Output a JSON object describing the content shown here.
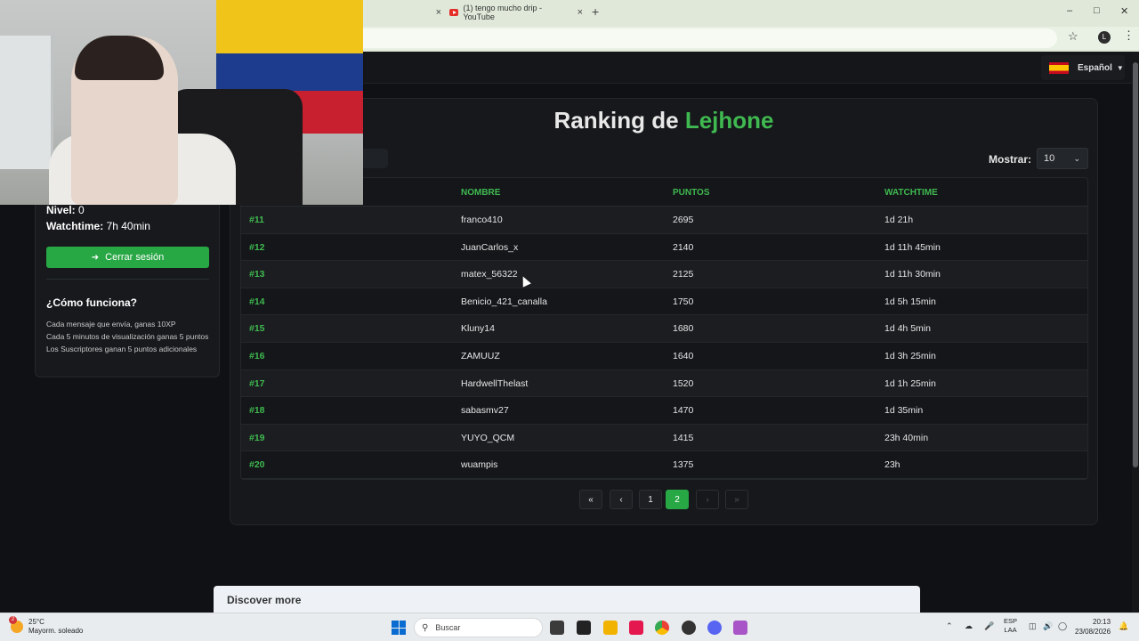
{
  "browser": {
    "tab1_close": "×",
    "tab2_title": "(1) tengo mucho drip - YouTube",
    "tab2_close": "×",
    "new_tab": "+",
    "profile_initial": "L"
  },
  "header": {
    "language": "Español"
  },
  "sidebar": {
    "nivel_label": "Nivel:",
    "nivel_value": "0",
    "watchtime_label": "Watchtime:",
    "watchtime_value": "7h 40min",
    "logout_label": "Cerrar sesión",
    "como_title": "¿Cómo funciona?",
    "rules": [
      "Cada mensaje que envía, ganas 10XP",
      "Cada 5 minutos de visualización ganas 5 puntos",
      "Los Suscriptores ganan 5 puntos adicionales"
    ]
  },
  "ranking": {
    "title_prefix": "Ranking de",
    "title_name": "Lejhone",
    "mostrar_label": "Mostrar:",
    "mostrar_value": "10",
    "columns": [
      "NOMBRE",
      "PUNTOS",
      "WATCHTIME"
    ],
    "rows": [
      {
        "rank": "#11",
        "name": "franco410",
        "points": "2695",
        "watchtime": "1d 21h"
      },
      {
        "rank": "#12",
        "name": "JuanCarlos_x",
        "points": "2140",
        "watchtime": "1d 11h 45min"
      },
      {
        "rank": "#13",
        "name": "matex_56322",
        "points": "2125",
        "watchtime": "1d 11h 30min"
      },
      {
        "rank": "#14",
        "name": "Benicio_421_canalla",
        "points": "1750",
        "watchtime": "1d 5h 15min"
      },
      {
        "rank": "#15",
        "name": "Kluny14",
        "points": "1680",
        "watchtime": "1d 4h 5min"
      },
      {
        "rank": "#16",
        "name": "ZAMUUZ",
        "points": "1640",
        "watchtime": "1d 3h 25min"
      },
      {
        "rank": "#17",
        "name": "HardwellThelast",
        "points": "1520",
        "watchtime": "1d 1h 25min"
      },
      {
        "rank": "#18",
        "name": "sabasmv27",
        "points": "1470",
        "watchtime": "1d 35min"
      },
      {
        "rank": "#19",
        "name": "YUYO_QCM",
        "points": "1415",
        "watchtime": "23h 40min"
      },
      {
        "rank": "#20",
        "name": "wuampis",
        "points": "1375",
        "watchtime": "23h"
      }
    ],
    "pagination": {
      "first": "«",
      "prev": "‹",
      "pages": [
        "1",
        "2"
      ],
      "current": "2",
      "next": "›",
      "last": "»"
    }
  },
  "discover": "Discover more",
  "taskbar": {
    "weather_temp": "25°C",
    "weather_desc": "Mayorm. soleado",
    "weather_badge": "2",
    "search": "Buscar",
    "lang_top": "ESP",
    "lang_bottom": "LAA",
    "time": "20:13",
    "date": "23/08/2026"
  },
  "colors": {
    "accent_green": "#3fb950",
    "button_green": "#28a745",
    "background": "#0f1114"
  }
}
